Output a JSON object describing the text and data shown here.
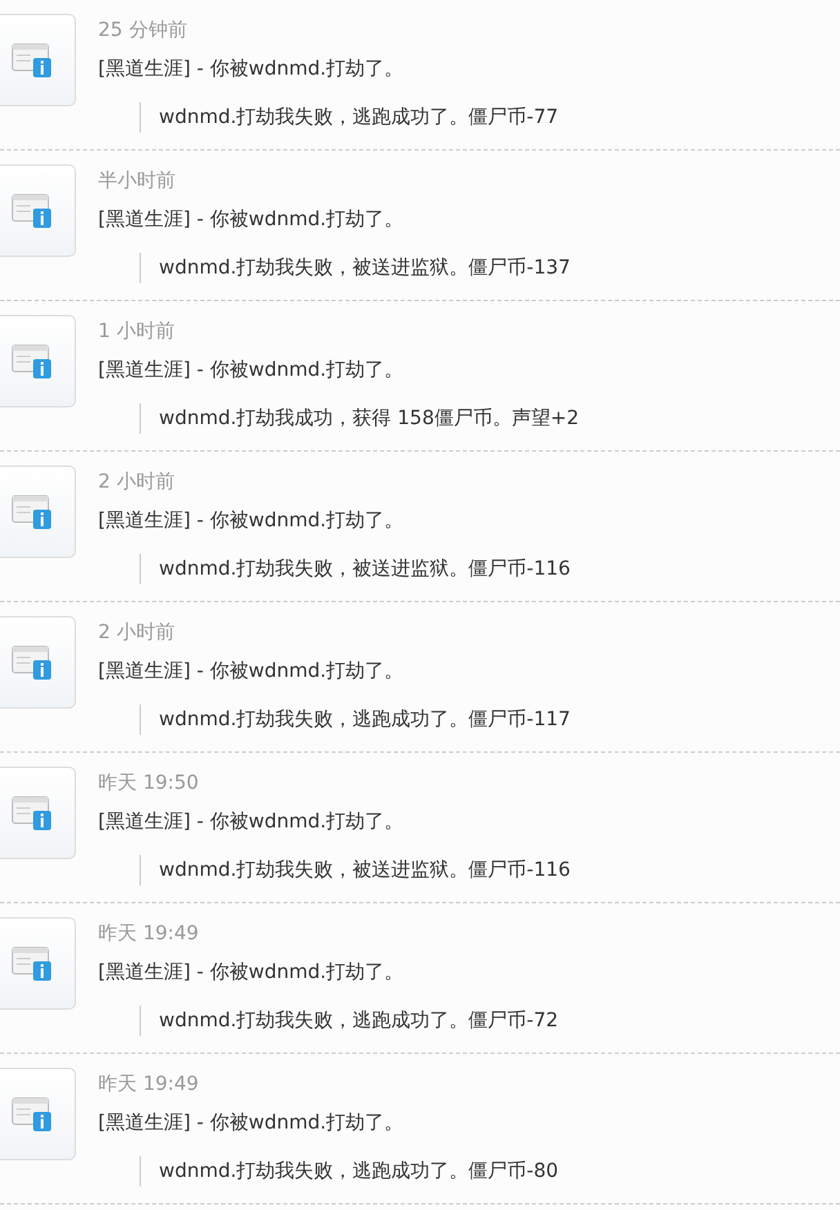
{
  "notifications": [
    {
      "time": "25 分钟前",
      "message": "[黑道生涯] - 你被wdnmd.打劫了。",
      "detail": "wdnmd.打劫我失败，逃跑成功了。僵尸币-77"
    },
    {
      "time": "半小时前",
      "message": "[黑道生涯] - 你被wdnmd.打劫了。",
      "detail": "wdnmd.打劫我失败，被送进监狱。僵尸币-137"
    },
    {
      "time": "1 小时前",
      "message": "[黑道生涯] - 你被wdnmd.打劫了。",
      "detail": "wdnmd.打劫我成功，获得 158僵尸币。声望+2"
    },
    {
      "time": "2 小时前",
      "message": "[黑道生涯] - 你被wdnmd.打劫了。",
      "detail": "wdnmd.打劫我失败，被送进监狱。僵尸币-116"
    },
    {
      "time": "2 小时前",
      "message": "[黑道生涯] - 你被wdnmd.打劫了。",
      "detail": "wdnmd.打劫我失败，逃跑成功了。僵尸币-117"
    },
    {
      "time": "昨天 19:50",
      "message": "[黑道生涯] - 你被wdnmd.打劫了。",
      "detail": "wdnmd.打劫我失败，被送进监狱。僵尸币-116"
    },
    {
      "time": "昨天 19:49",
      "message": "[黑道生涯] - 你被wdnmd.打劫了。",
      "detail": "wdnmd.打劫我失败，逃跑成功了。僵尸币-72"
    },
    {
      "time": "昨天 19:49",
      "message": "[黑道生涯] - 你被wdnmd.打劫了。",
      "detail": "wdnmd.打劫我失败，逃跑成功了。僵尸币-80"
    }
  ]
}
